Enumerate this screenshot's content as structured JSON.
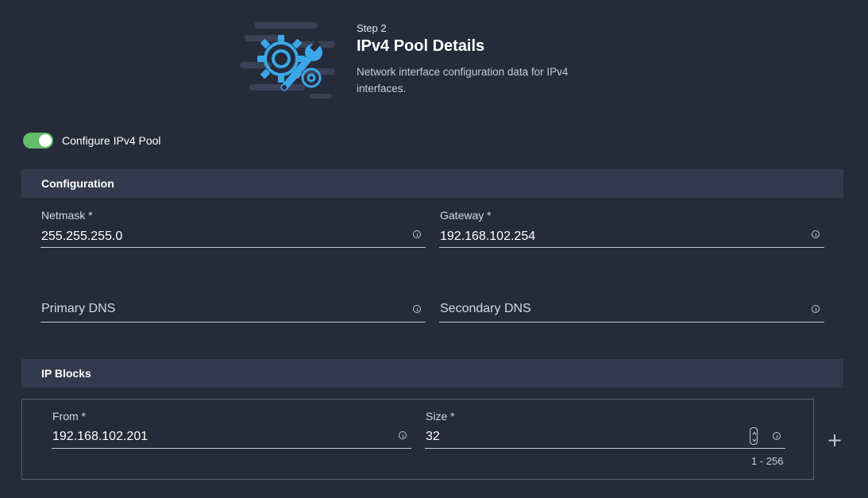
{
  "header": {
    "step": "Step 2",
    "title": "IPv4 Pool Details",
    "description": "Network interface configuration data for IPv4 interfaces."
  },
  "toggle": {
    "label": "Configure IPv4 Pool",
    "on": true
  },
  "configuration": {
    "section_title": "Configuration",
    "netmask": {
      "label": "Netmask *",
      "value": "255.255.255.0"
    },
    "gateway": {
      "label": "Gateway *",
      "value": "192.168.102.254"
    },
    "primary_dns": {
      "placeholder": "Primary DNS"
    },
    "secondary_dns": {
      "placeholder": "Secondary DNS"
    }
  },
  "ip_blocks": {
    "section_title": "IP Blocks",
    "from": {
      "label": "From *",
      "value": "192.168.102.201"
    },
    "size": {
      "label": "Size *",
      "value": "32",
      "range_hint": "1 - 256"
    },
    "add_label": "+"
  },
  "colors": {
    "background": "#262b3a",
    "section_header": "#343a4d",
    "toggle_on": "#66bb6a",
    "accent_icon": "#3aa8e8"
  }
}
